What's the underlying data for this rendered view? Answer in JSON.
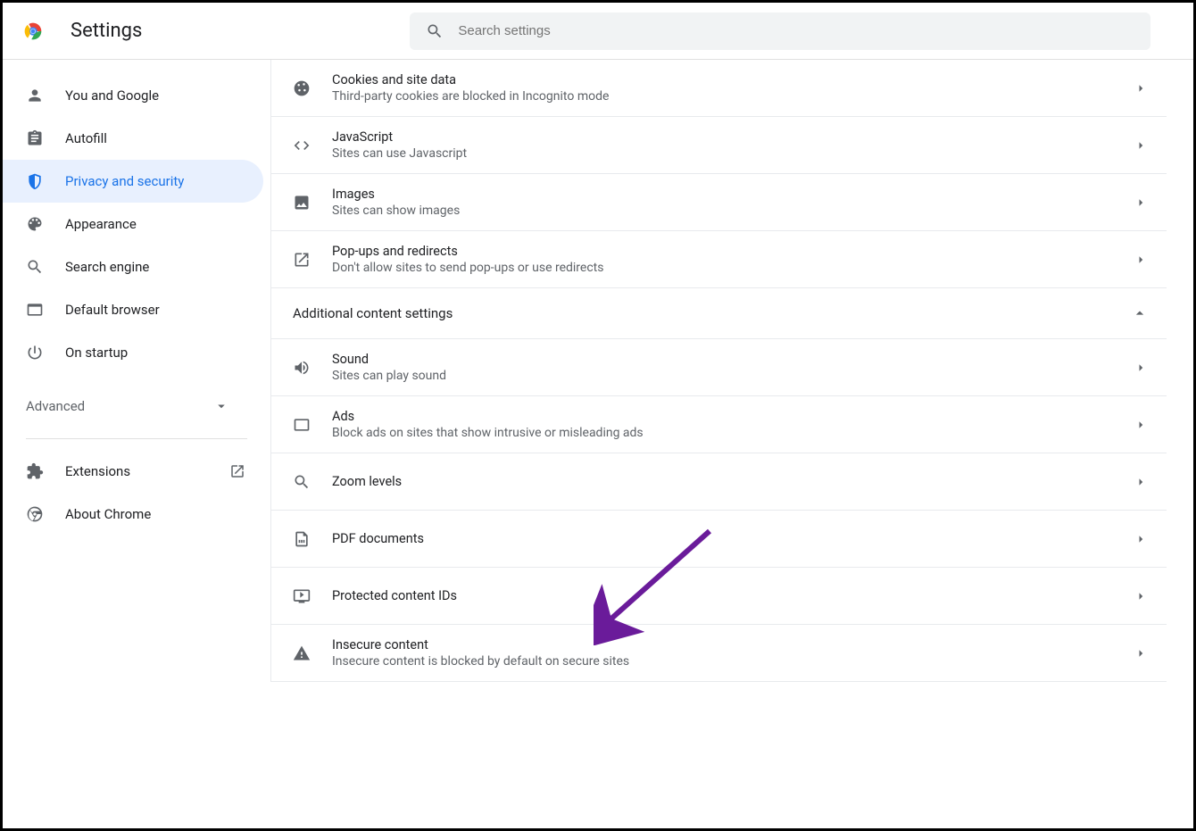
{
  "header": {
    "title": "Settings",
    "search_placeholder": "Search settings"
  },
  "sidebar": {
    "items": [
      {
        "label": "You and Google"
      },
      {
        "label": "Autofill"
      },
      {
        "label": "Privacy and security"
      },
      {
        "label": "Appearance"
      },
      {
        "label": "Search engine"
      },
      {
        "label": "Default browser"
      },
      {
        "label": "On startup"
      }
    ],
    "advanced_label": "Advanced",
    "footer": [
      {
        "label": "Extensions"
      },
      {
        "label": "About Chrome"
      }
    ]
  },
  "content": {
    "rows": [
      {
        "title": "Cookies and site data",
        "sub": "Third-party cookies are blocked in Incognito mode"
      },
      {
        "title": "JavaScript",
        "sub": "Sites can use Javascript"
      },
      {
        "title": "Images",
        "sub": "Sites can show images"
      },
      {
        "title": "Pop-ups and redirects",
        "sub": "Don't allow sites to send pop-ups or use redirects"
      }
    ],
    "section_header": "Additional content settings",
    "rows2": [
      {
        "title": "Sound",
        "sub": "Sites can play sound"
      },
      {
        "title": "Ads",
        "sub": "Block ads on sites that show intrusive or misleading ads"
      },
      {
        "title": "Zoom levels",
        "sub": ""
      },
      {
        "title": "PDF documents",
        "sub": ""
      },
      {
        "title": "Protected content IDs",
        "sub": ""
      },
      {
        "title": "Insecure content",
        "sub": "Insecure content is blocked by default on secure sites"
      }
    ]
  }
}
